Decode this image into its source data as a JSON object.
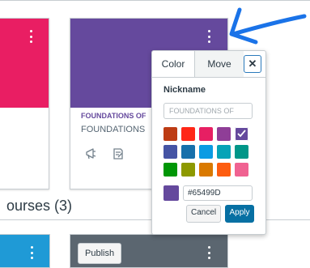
{
  "cards": {
    "main": {
      "color": "#65499D",
      "code": "FOUNDATIONS OF",
      "subtitle": "FOUNDATIONS",
      "icons": [
        "announcements-icon",
        "assignments-icon"
      ]
    },
    "left": {
      "color": "#e91e63"
    }
  },
  "section": {
    "heading": "ourses (3)"
  },
  "bottom_card": {
    "publish_label": "Publish"
  },
  "popover": {
    "tabs": [
      {
        "label": "Color"
      },
      {
        "label": "Move"
      }
    ],
    "close_label": "✕",
    "nickname_label": "Nickname",
    "nickname_placeholder": "FOUNDATIONS OF",
    "swatches": [
      "#bd3c14",
      "#ff2717",
      "#e71f63",
      "#8f3e97",
      "#65499d",
      "#4554a4",
      "#1770ab",
      "#0b9be3",
      "#06a3b7",
      "#009688",
      "#009606",
      "#8d9900",
      "#d97900",
      "#fd5d10",
      "#f06291"
    ],
    "selected_swatch_index": 4,
    "hex_value": "#65499D",
    "cancel_label": "Cancel",
    "apply_label": "Apply"
  },
  "annotation": {
    "arrow_color": "#1a73e8"
  }
}
